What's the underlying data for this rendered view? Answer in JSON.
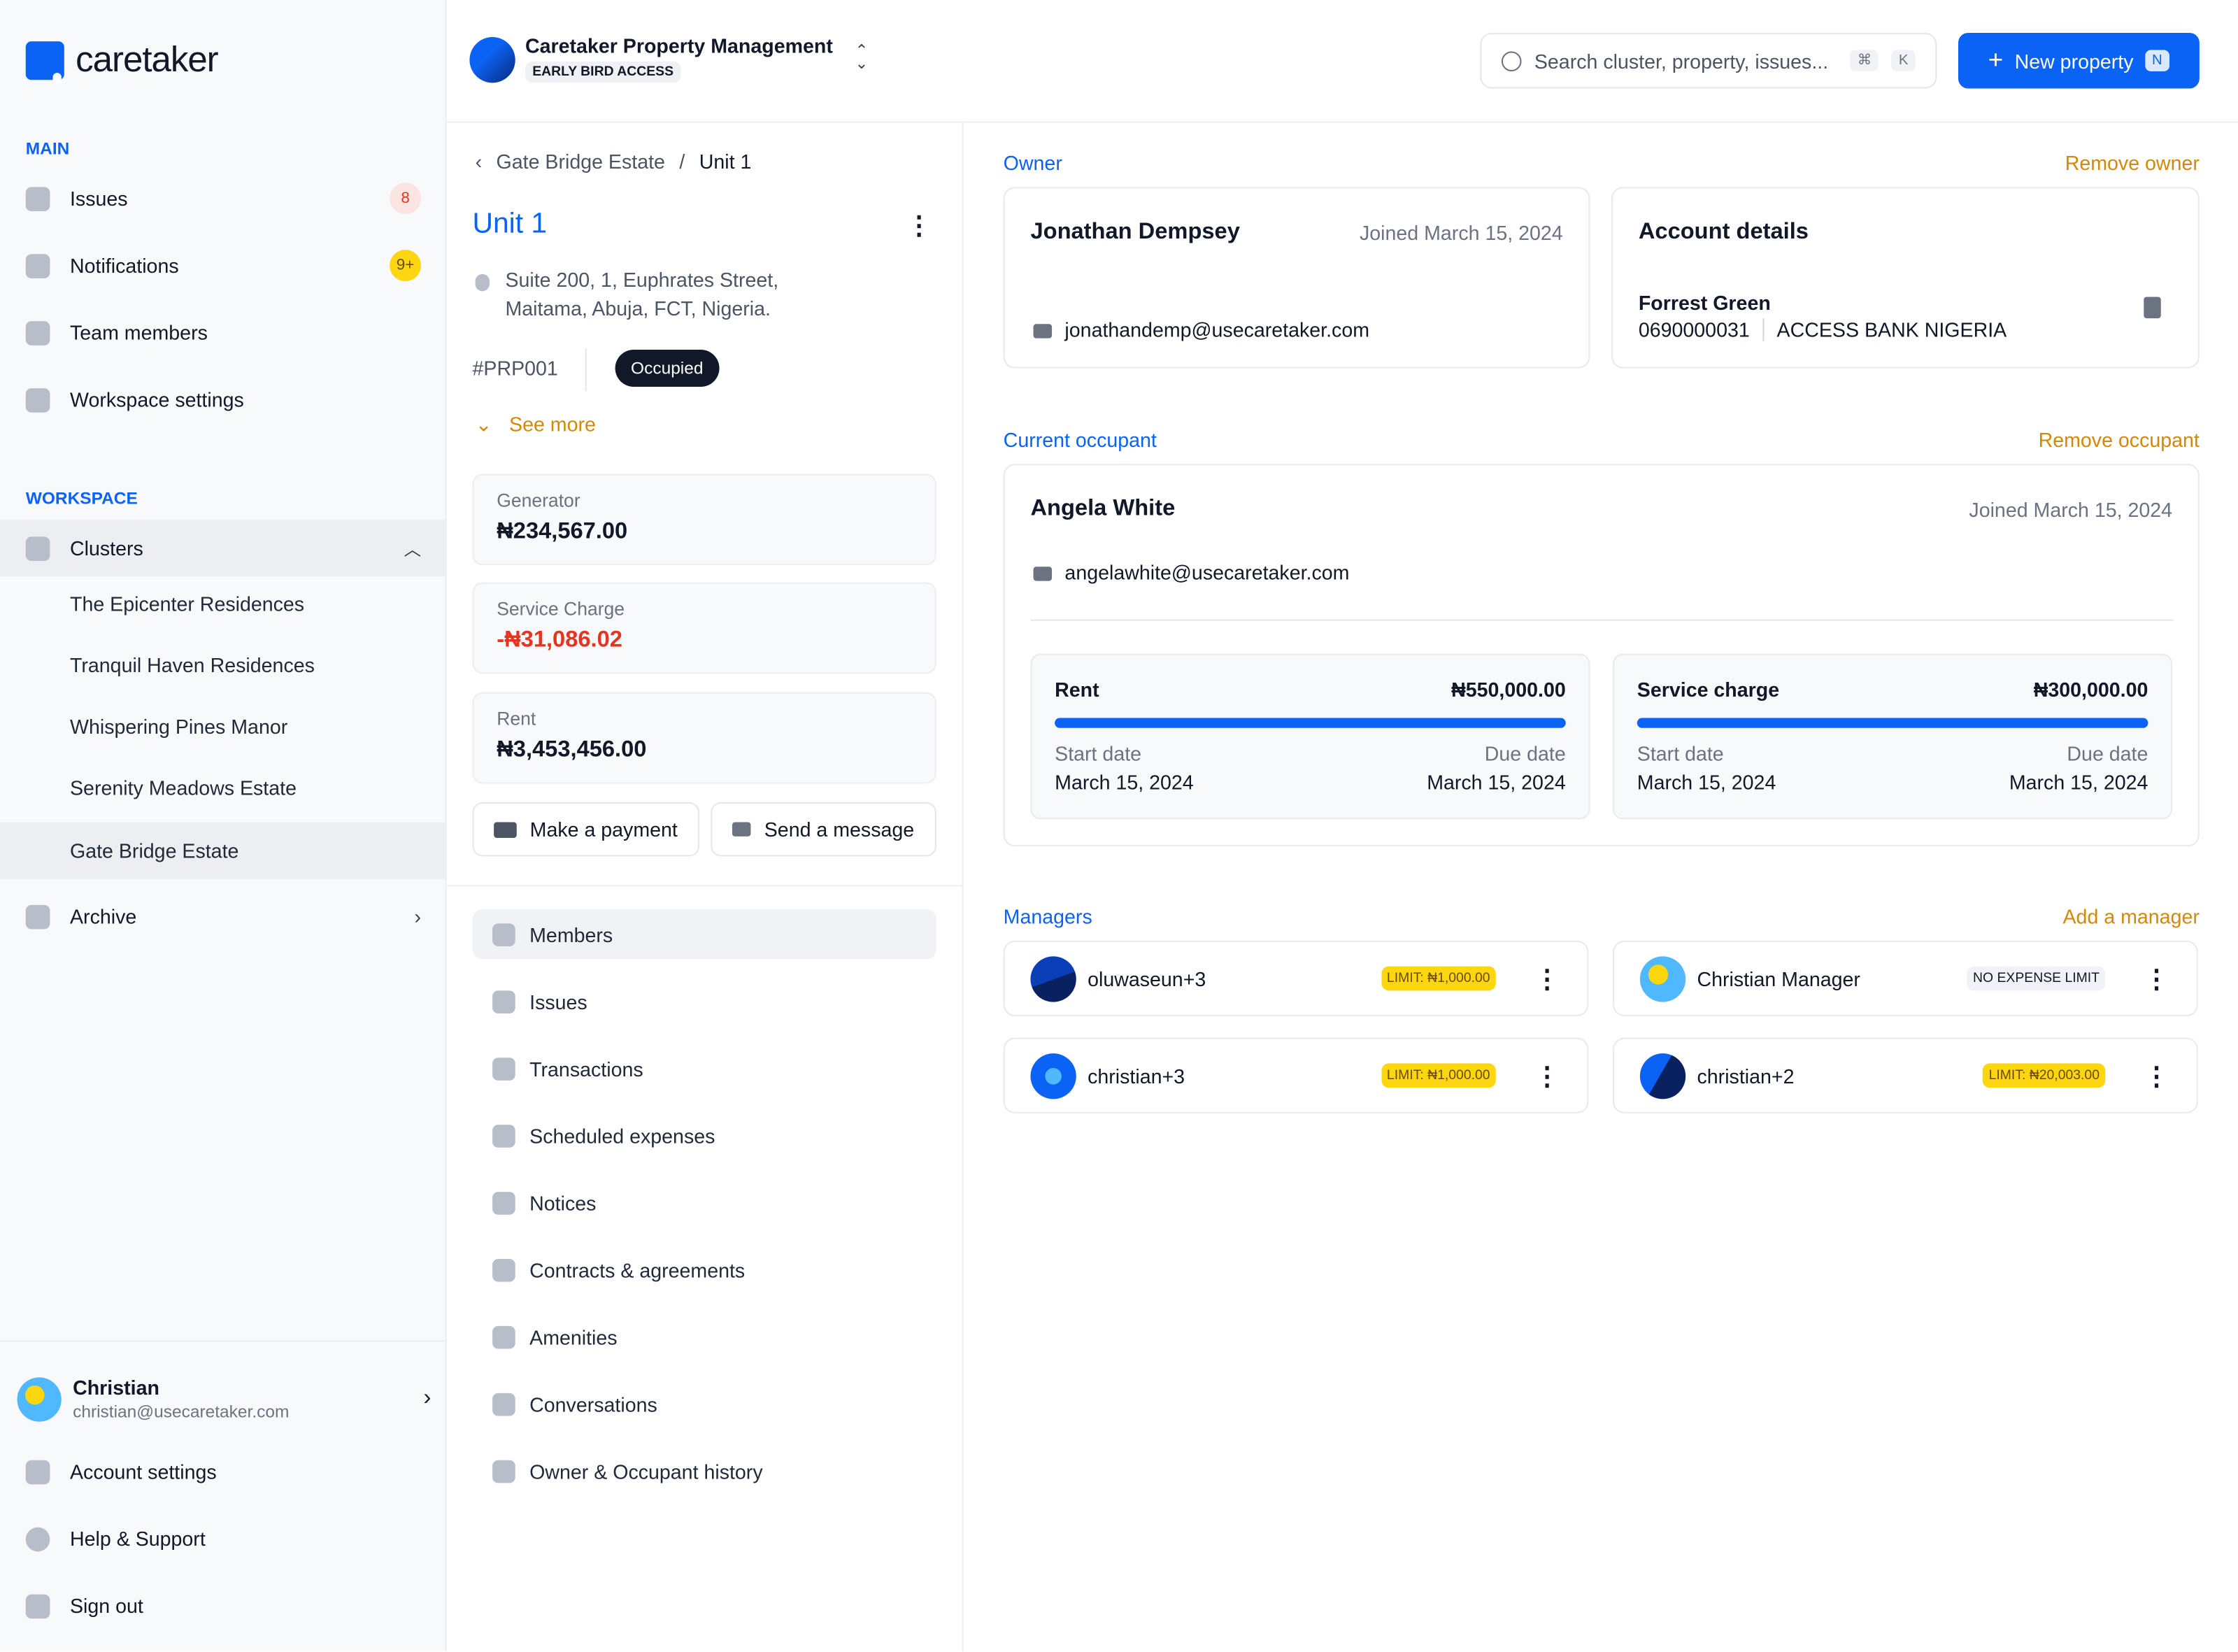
{
  "brand": {
    "name": "caretaker"
  },
  "sidebar": {
    "main_label": "MAIN",
    "main_items": [
      {
        "label": "Issues",
        "badge": "8"
      },
      {
        "label": "Notifications",
        "badge": "9+"
      },
      {
        "label": "Team members"
      },
      {
        "label": "Workspace settings"
      }
    ],
    "workspace_label": "WORKSPACE",
    "clusters_label": "Clusters",
    "clusters": [
      "The Epicenter Residences",
      "Tranquil Haven Residences",
      "Whispering Pines Manor",
      "Serenity Meadows Estate",
      "Gate Bridge Estate"
    ],
    "archive_label": "Archive",
    "user": {
      "name": "Christian",
      "email": "christian@usecaretaker.com"
    },
    "footer_items": [
      "Account settings",
      "Help & Support",
      "Sign out"
    ]
  },
  "topbar": {
    "org_name": "Caretaker Property Management",
    "org_tag": "EARLY BIRD ACCESS",
    "search_placeholder": "Search cluster, property, issues...",
    "search_kbd": [
      "⌘",
      "K"
    ],
    "new_property": "New property",
    "new_property_kbd": "N"
  },
  "property": {
    "breadcrumb": [
      "Gate Bridge Estate",
      "Unit 1"
    ],
    "title": "Unit 1",
    "address": [
      "Suite 200, 1, Euphrates Street,",
      "Maitama, Abuja, FCT, Nigeria."
    ],
    "code": "#PRP001",
    "status": "Occupied",
    "see_more": "See more",
    "stats": [
      {
        "label": "Generator",
        "value": "₦234,567.00"
      },
      {
        "label": "Service Charge",
        "value": "-₦31,086.02"
      },
      {
        "label": "Rent",
        "value": "₦3,453,456.00"
      }
    ],
    "make_payment": "Make a payment",
    "send_message": "Send a message",
    "menu": [
      "Members",
      "Issues",
      "Transactions",
      "Scheduled expenses",
      "Notices",
      "Contracts & agreements",
      "Amenities",
      "Conversations",
      "Owner & Occupant history"
    ]
  },
  "owner": {
    "section": "Owner",
    "action": "Remove owner",
    "name": "Jonathan Dempsey",
    "joined": "Joined March 15, 2024",
    "email": "jonathandemp@usecaretaker.com",
    "account": {
      "title": "Account details",
      "holder": "Forrest Green",
      "number": "0690000031",
      "bank": "ACCESS BANK NIGERIA"
    }
  },
  "occupant": {
    "section": "Current occupant",
    "action": "Remove occupant",
    "name": "Angela White",
    "joined": "Joined March 15, 2024",
    "email": "angelawhite@usecaretaker.com",
    "payments": [
      {
        "label": "Rent",
        "amount": "₦550,000.00",
        "progress": 1.0,
        "start_label": "Start date",
        "start": "March 15, 2024",
        "due_label": "Due date",
        "due": "March 15, 2024"
      },
      {
        "label": "Service charge",
        "amount": "₦300,000.00",
        "progress": 1.0,
        "start_label": "Start date",
        "start": "March 15, 2024",
        "due_label": "Due date",
        "due": "March 15, 2024"
      }
    ]
  },
  "managers": {
    "section": "Managers",
    "action": "Add a manager",
    "items": [
      {
        "name": "oluwaseun+3",
        "limit": "LIMIT: ₦1,000.00"
      },
      {
        "name": "Christian Manager",
        "limit": "NO EXPENSE LIMIT"
      },
      {
        "name": "christian+3",
        "limit": "LIMIT: ₦1,000.00"
      },
      {
        "name": "christian+2",
        "limit": "LIMIT: ₦20,003.00"
      }
    ]
  },
  "colors": {
    "accent": "#0b63f6",
    "warning": "#d48806",
    "negative": "#e5341f",
    "limit_badge": "#fcd60f"
  }
}
